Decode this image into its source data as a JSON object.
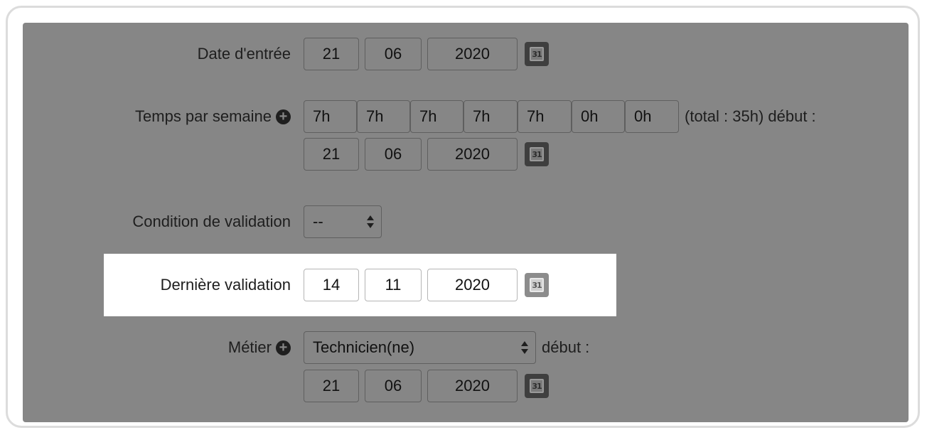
{
  "rows": {
    "date_entree": {
      "label": "Date d'entrée",
      "day": "21",
      "month": "06",
      "year": "2020",
      "calendar_icon": "calendar-icon"
    },
    "temps_semaine": {
      "label": "Temps par semaine",
      "add_icon": "plus-circle-icon",
      "hours": [
        "7h",
        "7h",
        "7h",
        "7h",
        "7h",
        "0h",
        "0h"
      ],
      "total_text": "(total : 35h) début :",
      "day": "21",
      "month": "06",
      "year": "2020",
      "calendar_icon": "calendar-icon"
    },
    "condition_validation": {
      "label": "Condition de validation",
      "selected": "--"
    },
    "derniere_validation": {
      "label": "Dernière validation",
      "day": "14",
      "month": "11",
      "year": "2020",
      "calendar_icon": "calendar-icon"
    },
    "metier": {
      "label": "Métier",
      "add_icon": "plus-circle-icon",
      "selected": "Technicien(ne)",
      "debut_text": "début :",
      "day": "21",
      "month": "06",
      "year": "2020",
      "calendar_icon": "calendar-icon"
    }
  },
  "calendar_glyph": "31",
  "plus_glyph": "+",
  "colors": {
    "overlay": "#868686",
    "highlight": "#ffffff",
    "text": "#1e1e1e"
  }
}
